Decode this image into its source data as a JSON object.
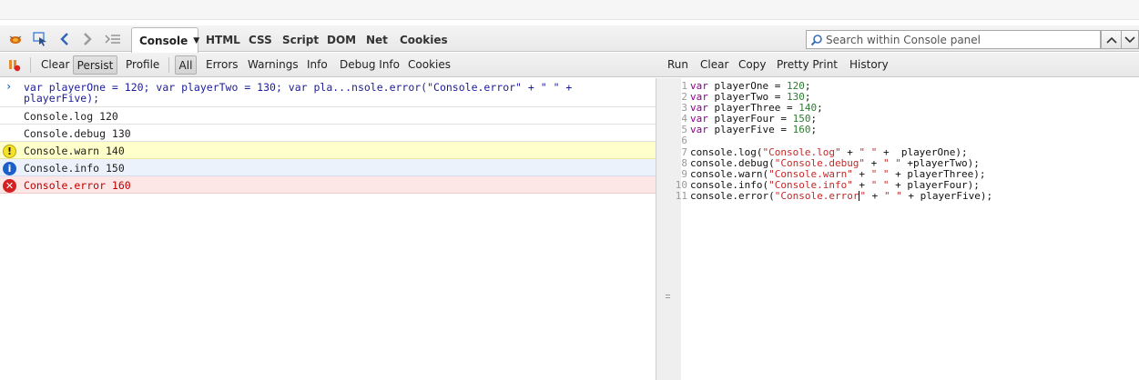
{
  "toolbar": {
    "tabs": [
      "HTML",
      "CSS",
      "Script",
      "DOM",
      "Net",
      "Cookies"
    ],
    "active_tab": "Console",
    "search_placeholder": "Search within Console panel"
  },
  "console_toolbar": {
    "clear": "Clear",
    "persist": "Persist",
    "profile": "Profile",
    "filters": [
      "All",
      "Errors",
      "Warnings",
      "Info",
      "Debug Info",
      "Cookies"
    ],
    "active_filter": "All"
  },
  "editor_toolbar": {
    "run": "Run",
    "clear": "Clear",
    "copy": "Copy",
    "pretty_print": "Pretty Print",
    "history": "History"
  },
  "console": {
    "command_line1": "var playerOne = 120; var playerTwo = 130; var pla...nsole.error(\"Console.error\" + \" \" +",
    "command_line2": "playerFive);",
    "log": "Console.log 120",
    "debug": "Console.debug 130",
    "warn": "Console.warn 140",
    "info": "Console.info 150",
    "error": "Console.error 160"
  },
  "editor": {
    "line_numbers": [
      "1",
      "2",
      "3",
      "4",
      "5",
      "6",
      "7",
      "8",
      "9",
      "10",
      "11"
    ],
    "lines": [
      [
        {
          "t": "kw",
          "v": "var"
        },
        {
          "t": "p",
          "v": " playerOne = "
        },
        {
          "t": "num",
          "v": "120"
        },
        {
          "t": "p",
          "v": ";"
        }
      ],
      [
        {
          "t": "kw",
          "v": "var"
        },
        {
          "t": "p",
          "v": " playerTwo = "
        },
        {
          "t": "num",
          "v": "130"
        },
        {
          "t": "p",
          "v": ";"
        }
      ],
      [
        {
          "t": "kw",
          "v": "var"
        },
        {
          "t": "p",
          "v": " playerThree = "
        },
        {
          "t": "num",
          "v": "140"
        },
        {
          "t": "p",
          "v": ";"
        }
      ],
      [
        {
          "t": "kw",
          "v": "var"
        },
        {
          "t": "p",
          "v": " playerFour = "
        },
        {
          "t": "num",
          "v": "150"
        },
        {
          "t": "p",
          "v": ";"
        }
      ],
      [
        {
          "t": "kw",
          "v": "var"
        },
        {
          "t": "p",
          "v": " playerFive = "
        },
        {
          "t": "num",
          "v": "160"
        },
        {
          "t": "p",
          "v": ";"
        }
      ],
      [],
      [
        {
          "t": "p",
          "v": "console.log("
        },
        {
          "t": "str",
          "v": "\"Console.log\""
        },
        {
          "t": "p",
          "v": " + "
        },
        {
          "t": "str",
          "v": "\" \""
        },
        {
          "t": "p",
          "v": " +  playerOne);"
        }
      ],
      [
        {
          "t": "p",
          "v": "console.debug("
        },
        {
          "t": "str",
          "v": "\"Console.debug\""
        },
        {
          "t": "p",
          "v": " + "
        },
        {
          "t": "str",
          "v": "\" \""
        },
        {
          "t": "p",
          "v": " +playerTwo);"
        }
      ],
      [
        {
          "t": "p",
          "v": "console.warn("
        },
        {
          "t": "str",
          "v": "\"Console.warn\""
        },
        {
          "t": "p",
          "v": " + "
        },
        {
          "t": "str",
          "v": "\" \""
        },
        {
          "t": "p",
          "v": " + playerThree);"
        }
      ],
      [
        {
          "t": "p",
          "v": "console.info("
        },
        {
          "t": "str",
          "v": "\"Console.info\""
        },
        {
          "t": "p",
          "v": " + "
        },
        {
          "t": "str",
          "v": "\" \""
        },
        {
          "t": "p",
          "v": " + playerFour);"
        }
      ],
      [
        {
          "t": "p",
          "v": "console.error("
        },
        {
          "t": "str",
          "v": "\"Console.error"
        },
        {
          "t": "caret",
          "v": ""
        },
        {
          "t": "str",
          "v": "\""
        },
        {
          "t": "p",
          "v": " + "
        },
        {
          "t": "str",
          "v": "\" \""
        },
        {
          "t": "p",
          "v": " + playerFive);"
        }
      ]
    ]
  },
  "colors": {
    "warn_bg": "#ffffcc",
    "info_bg": "#ebf2fb",
    "error_bg": "#fde6e6",
    "error_text": "#c00000",
    "keyword": "#8b008b",
    "number": "#2e7d32",
    "string": "#c62828"
  }
}
